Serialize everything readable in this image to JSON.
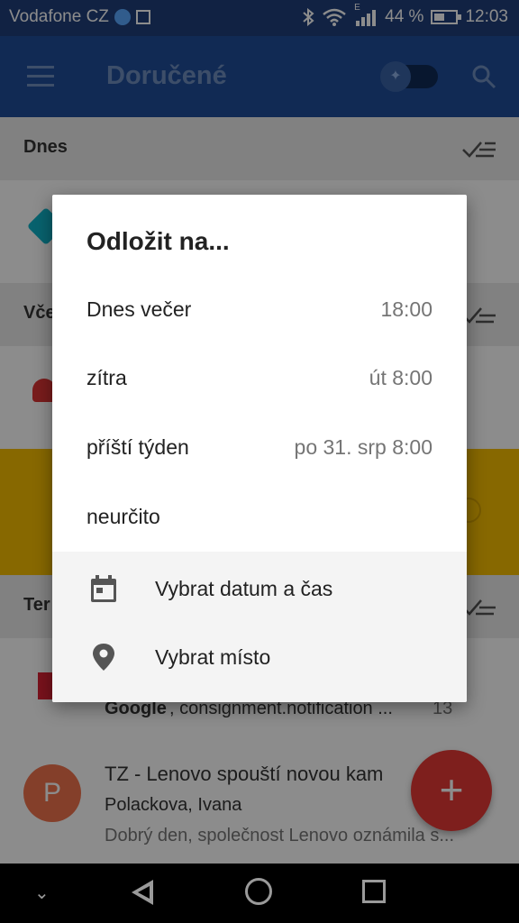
{
  "status_bar": {
    "carrier": "Vodafone CZ",
    "battery": "44 %",
    "time": "12:03",
    "network": "E"
  },
  "app_bar": {
    "title": "Doručené"
  },
  "list": {
    "section_today": "Dnes",
    "section_yesterday": "Vče",
    "section_earlier": "Ter",
    "row1_sender": "Google",
    "row1_snippet": ", consignment.notification ...",
    "row1_count": "13",
    "row2_subject": "TZ - Lenovo spouští novou kam",
    "row2_from": "Polackova, Ivana",
    "row2_snippet": "Dobrý den, společnost Lenovo oznámila s...",
    "row2_avatar_letter": "P"
  },
  "dialog": {
    "title": "Odložit na...",
    "options": [
      {
        "label": "Dnes večer",
        "value": "18:00"
      },
      {
        "label": "zítra",
        "value": "út 8:00"
      },
      {
        "label": "příští týden",
        "value": "po 31. srp 8:00"
      },
      {
        "label": "neurčito",
        "value": ""
      }
    ],
    "pick_date": "Vybrat datum a čas",
    "pick_place": "Vybrat místo"
  },
  "fab": {
    "label": "+"
  },
  "colors": {
    "app_bar": "#1f4d9a",
    "status_bar": "#1f3f7a",
    "fab": "#e53935",
    "highlight_row": "#f6be00"
  }
}
